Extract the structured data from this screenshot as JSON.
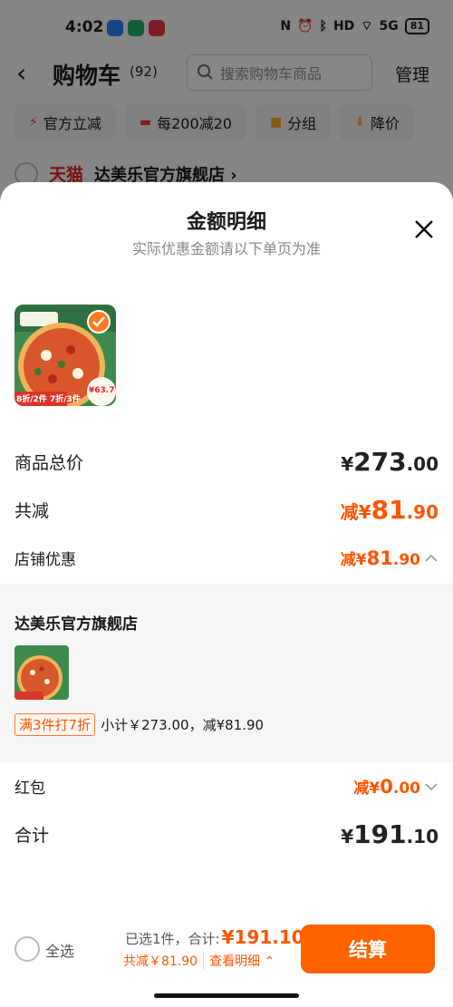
{
  "status_bar": {
    "time": "4:02",
    "signal": "5G",
    "battery": "81"
  },
  "nav": {
    "title": "购物车",
    "count": "(92)",
    "search_placeholder": "搜索购物车商品",
    "manage": "管理"
  },
  "filters": [
    {
      "icon": "lightning-icon",
      "label": "官方立减"
    },
    {
      "icon": "coupon-icon",
      "label": "每200减20"
    },
    {
      "icon": "folder-icon",
      "label": "分组"
    },
    {
      "icon": "down-arrow-icon",
      "label": "降价"
    }
  ],
  "bg_shop": {
    "platform": "天猫",
    "name": "达美乐官方旗舰店 ›"
  },
  "sheet": {
    "title": "金额明细",
    "subtitle": "实际优惠金额请以下单页为准",
    "product_badge": "8折/2件 7折/3件",
    "product_price_tag": "¥63.7",
    "rows": {
      "total": {
        "label": "商品总价",
        "currency": "¥",
        "int": "273",
        "dec": ".00"
      },
      "discount": {
        "label": "共减",
        "prefix": "减¥",
        "int": "81",
        "dec": ".90"
      },
      "shop_discount": {
        "label": "店铺优惠",
        "prefix": "减¥",
        "int": "81",
        "dec": ".90"
      }
    },
    "shop_detail": {
      "shop_name": "达美乐官方旗舰店",
      "promo_tag": "满3件打7折",
      "summary": "小计￥273.00，减¥81.90"
    },
    "red_packet": {
      "label": "红包",
      "prefix": "减¥",
      "int": "0",
      "dec": ".00"
    },
    "grand_total": {
      "label": "合计",
      "currency": "¥",
      "int": "191",
      "dec": ".10"
    }
  },
  "footer": {
    "select_all": "全选",
    "selected": "已选1件，合计:",
    "total": "¥191.10",
    "saved": "共减￥81.90",
    "detail_link": "查看明细 ⌃",
    "pay_button": "结算"
  },
  "colors": {
    "accent": "#ff5500",
    "pay_button": "#ff6200"
  }
}
